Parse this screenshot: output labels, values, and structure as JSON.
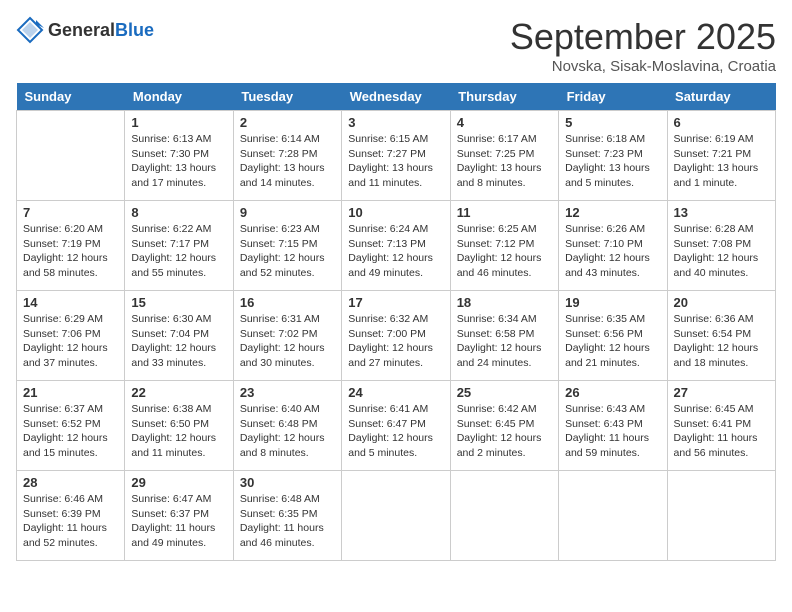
{
  "header": {
    "logo_general": "General",
    "logo_blue": "Blue",
    "month": "September 2025",
    "location": "Novska, Sisak-Moslavina, Croatia"
  },
  "days": [
    "Sunday",
    "Monday",
    "Tuesday",
    "Wednesday",
    "Thursday",
    "Friday",
    "Saturday"
  ],
  "weeks": [
    [
      {
        "date": "",
        "info": ""
      },
      {
        "date": "1",
        "info": "Sunrise: 6:13 AM\nSunset: 7:30 PM\nDaylight: 13 hours\nand 17 minutes."
      },
      {
        "date": "2",
        "info": "Sunrise: 6:14 AM\nSunset: 7:28 PM\nDaylight: 13 hours\nand 14 minutes."
      },
      {
        "date": "3",
        "info": "Sunrise: 6:15 AM\nSunset: 7:27 PM\nDaylight: 13 hours\nand 11 minutes."
      },
      {
        "date": "4",
        "info": "Sunrise: 6:17 AM\nSunset: 7:25 PM\nDaylight: 13 hours\nand 8 minutes."
      },
      {
        "date": "5",
        "info": "Sunrise: 6:18 AM\nSunset: 7:23 PM\nDaylight: 13 hours\nand 5 minutes."
      },
      {
        "date": "6",
        "info": "Sunrise: 6:19 AM\nSunset: 7:21 PM\nDaylight: 13 hours\nand 1 minute."
      }
    ],
    [
      {
        "date": "7",
        "info": "Sunrise: 6:20 AM\nSunset: 7:19 PM\nDaylight: 12 hours\nand 58 minutes."
      },
      {
        "date": "8",
        "info": "Sunrise: 6:22 AM\nSunset: 7:17 PM\nDaylight: 12 hours\nand 55 minutes."
      },
      {
        "date": "9",
        "info": "Sunrise: 6:23 AM\nSunset: 7:15 PM\nDaylight: 12 hours\nand 52 minutes."
      },
      {
        "date": "10",
        "info": "Sunrise: 6:24 AM\nSunset: 7:13 PM\nDaylight: 12 hours\nand 49 minutes."
      },
      {
        "date": "11",
        "info": "Sunrise: 6:25 AM\nSunset: 7:12 PM\nDaylight: 12 hours\nand 46 minutes."
      },
      {
        "date": "12",
        "info": "Sunrise: 6:26 AM\nSunset: 7:10 PM\nDaylight: 12 hours\nand 43 minutes."
      },
      {
        "date": "13",
        "info": "Sunrise: 6:28 AM\nSunset: 7:08 PM\nDaylight: 12 hours\nand 40 minutes."
      }
    ],
    [
      {
        "date": "14",
        "info": "Sunrise: 6:29 AM\nSunset: 7:06 PM\nDaylight: 12 hours\nand 37 minutes."
      },
      {
        "date": "15",
        "info": "Sunrise: 6:30 AM\nSunset: 7:04 PM\nDaylight: 12 hours\nand 33 minutes."
      },
      {
        "date": "16",
        "info": "Sunrise: 6:31 AM\nSunset: 7:02 PM\nDaylight: 12 hours\nand 30 minutes."
      },
      {
        "date": "17",
        "info": "Sunrise: 6:32 AM\nSunset: 7:00 PM\nDaylight: 12 hours\nand 27 minutes."
      },
      {
        "date": "18",
        "info": "Sunrise: 6:34 AM\nSunset: 6:58 PM\nDaylight: 12 hours\nand 24 minutes."
      },
      {
        "date": "19",
        "info": "Sunrise: 6:35 AM\nSunset: 6:56 PM\nDaylight: 12 hours\nand 21 minutes."
      },
      {
        "date": "20",
        "info": "Sunrise: 6:36 AM\nSunset: 6:54 PM\nDaylight: 12 hours\nand 18 minutes."
      }
    ],
    [
      {
        "date": "21",
        "info": "Sunrise: 6:37 AM\nSunset: 6:52 PM\nDaylight: 12 hours\nand 15 minutes."
      },
      {
        "date": "22",
        "info": "Sunrise: 6:38 AM\nSunset: 6:50 PM\nDaylight: 12 hours\nand 11 minutes."
      },
      {
        "date": "23",
        "info": "Sunrise: 6:40 AM\nSunset: 6:48 PM\nDaylight: 12 hours\nand 8 minutes."
      },
      {
        "date": "24",
        "info": "Sunrise: 6:41 AM\nSunset: 6:47 PM\nDaylight: 12 hours\nand 5 minutes."
      },
      {
        "date": "25",
        "info": "Sunrise: 6:42 AM\nSunset: 6:45 PM\nDaylight: 12 hours\nand 2 minutes."
      },
      {
        "date": "26",
        "info": "Sunrise: 6:43 AM\nSunset: 6:43 PM\nDaylight: 11 hours\nand 59 minutes."
      },
      {
        "date": "27",
        "info": "Sunrise: 6:45 AM\nSunset: 6:41 PM\nDaylight: 11 hours\nand 56 minutes."
      }
    ],
    [
      {
        "date": "28",
        "info": "Sunrise: 6:46 AM\nSunset: 6:39 PM\nDaylight: 11 hours\nand 52 minutes."
      },
      {
        "date": "29",
        "info": "Sunrise: 6:47 AM\nSunset: 6:37 PM\nDaylight: 11 hours\nand 49 minutes."
      },
      {
        "date": "30",
        "info": "Sunrise: 6:48 AM\nSunset: 6:35 PM\nDaylight: 11 hours\nand 46 minutes."
      },
      {
        "date": "",
        "info": ""
      },
      {
        "date": "",
        "info": ""
      },
      {
        "date": "",
        "info": ""
      },
      {
        "date": "",
        "info": ""
      }
    ]
  ]
}
